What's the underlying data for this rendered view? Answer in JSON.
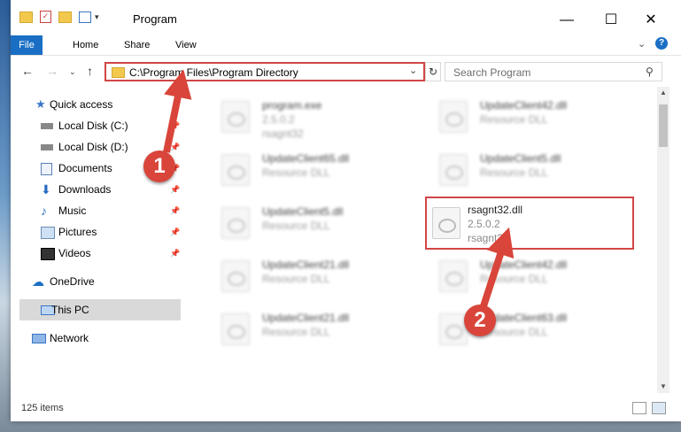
{
  "window": {
    "title": "Program"
  },
  "ribbon": {
    "tabs": [
      "File",
      "Home",
      "Share",
      "View"
    ]
  },
  "address": {
    "path": "C:\\Program Files\\Program Directory"
  },
  "search": {
    "placeholder": "Search Program"
  },
  "sidebar": {
    "items": [
      {
        "label": "Quick access"
      },
      {
        "label": "Local Disk (C:)"
      },
      {
        "label": "Local Disk (D:)"
      },
      {
        "label": "Documents"
      },
      {
        "label": "Downloads"
      },
      {
        "label": "Music"
      },
      {
        "label": "Pictures"
      },
      {
        "label": "Videos"
      },
      {
        "label": "OneDrive"
      },
      {
        "label": "This PC"
      },
      {
        "label": "Network"
      }
    ]
  },
  "files": [
    {
      "name": "program.exe",
      "line1": "2.5.0.2",
      "line2": "rsagnt32"
    },
    {
      "name": "UpdateClient42.dll",
      "line1": "Resource DLL"
    },
    {
      "name": "UpdateClient65.dll",
      "line1": "Resource DLL"
    },
    {
      "name": "UpdateClient5.dll",
      "line1": "Resource DLL"
    },
    {
      "name": "UpdateClient5.dll",
      "line1": "Resource DLL"
    },
    {
      "name": "rsagnt32.dll",
      "line1": "2.5.0.2",
      "line2": "rsagnt32"
    },
    {
      "name": "UpdateClient21.dll",
      "line1": "Resource DLL"
    },
    {
      "name": "UpdateClient42.dll",
      "line1": "Resource DLL"
    },
    {
      "name": "UpdateClient21.dll",
      "line1": "Resource DLL"
    },
    {
      "name": "UpdateClient63.dll",
      "line1": "Resource DLL"
    }
  ],
  "status": {
    "count": "125 items"
  },
  "callouts": {
    "one": "1",
    "two": "2"
  },
  "colors": {
    "accent": "#1a6fc4",
    "highlight": "#d24545",
    "callout": "#d9453a"
  }
}
